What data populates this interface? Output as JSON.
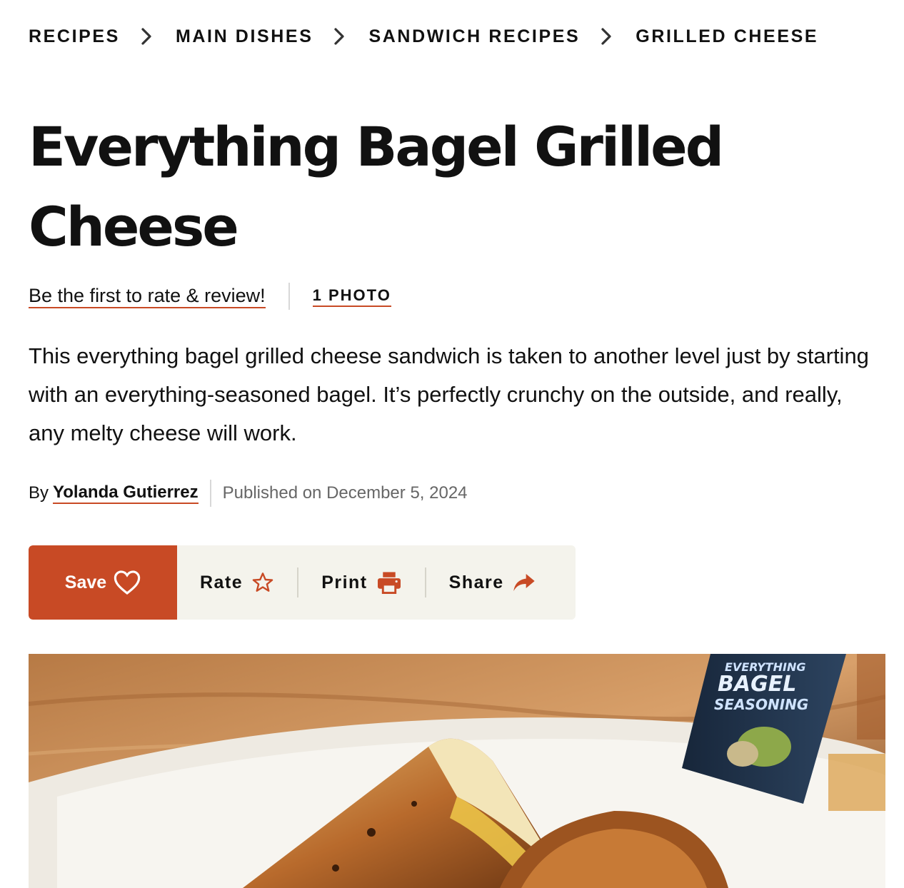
{
  "breadcrumb": [
    "RECIPES",
    "MAIN DISHES",
    "SANDWICH RECIPES",
    "GRILLED CHEESE"
  ],
  "title": "Everything Bagel Grilled Cheese",
  "rating_link": "Be the first to rate & review!",
  "photo_link": "1 PHOTO",
  "description": "This everything bagel grilled cheese sandwich is taken to another level just by starting with an everything-seasoned bagel. It’s perfectly crunchy on the outside, and really, any melty cheese will work.",
  "byline": {
    "prefix": "By",
    "author": "Yolanda Gutierrez",
    "published": "Published on December 5, 2024"
  },
  "actions": {
    "save": "Save",
    "rate": "Rate",
    "print": "Print",
    "share": "Share"
  },
  "hero": {
    "jar_label": [
      "EVERYTHING",
      "BAGEL",
      "SEASONING"
    ],
    "icon": "grilled-cheese-photo"
  },
  "colors": {
    "accent": "#c84a25",
    "action_bar_bg": "#f4f3ec",
    "text": "#111111",
    "muted": "#666666"
  }
}
